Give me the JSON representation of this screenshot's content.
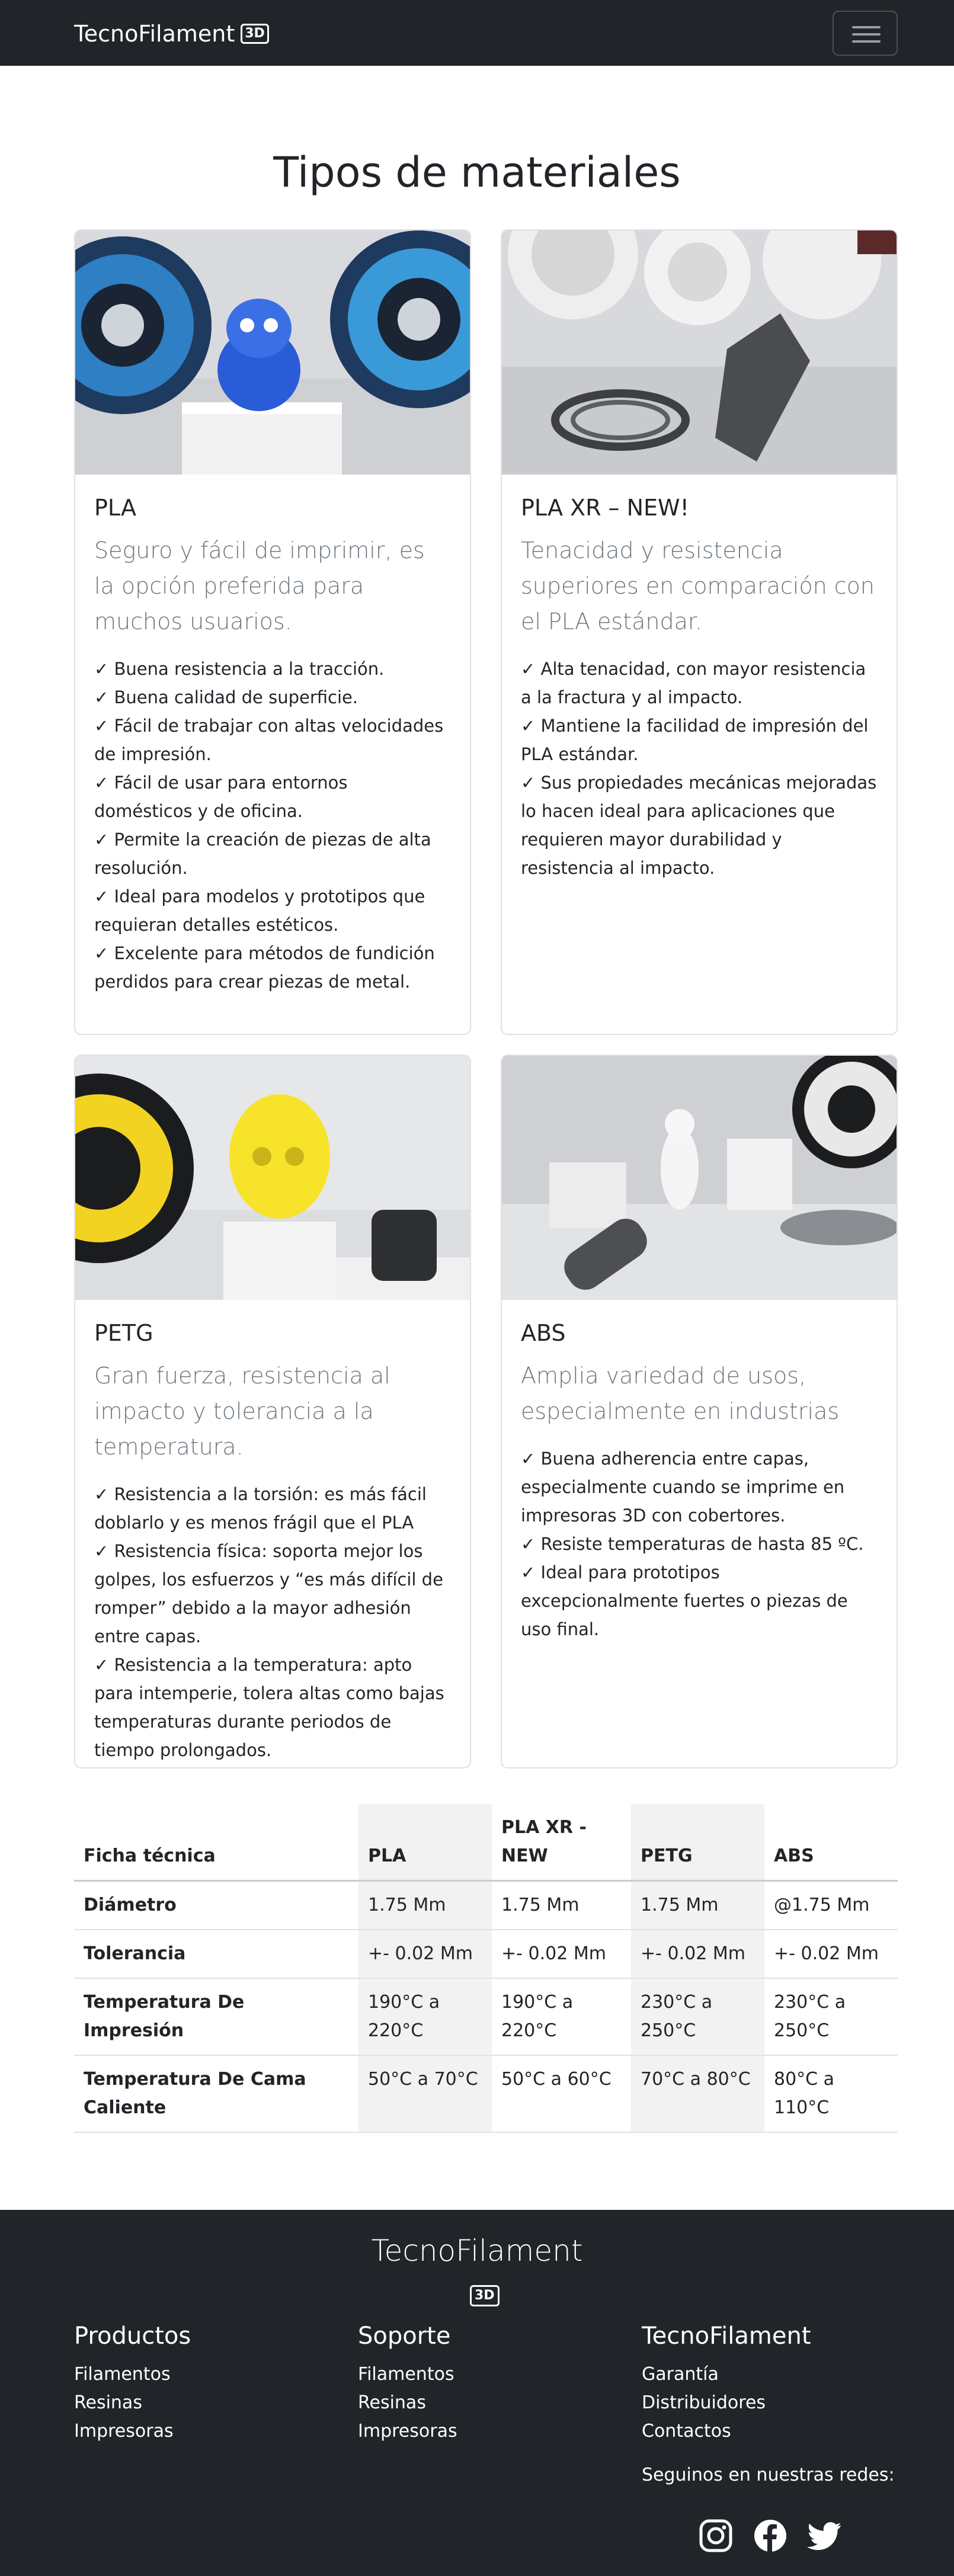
{
  "navbar": {
    "brand": "TecnoFilament",
    "badge": "3D"
  },
  "page_title": "Tipos de materiales",
  "cards": [
    {
      "title": "PLA",
      "lead": "Seguro y fácil de imprimir, es la opción preferida para muchos usuarios.",
      "features": [
        "✓ Buena resistencia a la tracción.",
        "✓ Buena calidad de superficie.",
        "✓ Fácil de trabajar con altas velocidades de impresión.",
        "✓ Fácil de usar para entornos domésticos y de oficina.",
        "✓ Permite la creación de piezas de alta resolución.",
        "✓ Ideal para modelos y prototipos que requieran detalles estéticos.",
        "✓ Excelente para métodos de fundición perdidos para crear piezas de metal."
      ]
    },
    {
      "title": "PLA XR – NEW!",
      "lead": "Tenacidad y resistencia superiores en comparación con el PLA estándar.",
      "features": [
        "✓ Alta tenacidad, con mayor resistencia a la fractura y al impacto.",
        "✓ Mantiene la facilidad de impresión del PLA estándar.",
        "✓ Sus propiedades mecánicas mejoradas lo hacen ideal para aplicaciones que requieren mayor durabilidad y resistencia al impacto."
      ]
    },
    {
      "title": "PETG",
      "lead": "Gran fuerza, resistencia al impacto y tolerancia a la temperatura.",
      "features": [
        "✓ Resistencia a la torsión: es más fácil doblarlo y es menos frágil que el PLA",
        "✓ Resistencia física: soporta mejor los golpes, los esfuerzos y “es más difícil de romper” debido a la mayor adhesión entre capas.",
        "✓ Resistencia a la temperatura: apto para intemperie, tolera altas como bajas temperaturas durante periodos de tiempo prolongados."
      ]
    },
    {
      "title": "ABS",
      "lead": "Amplia variedad de usos, especialmente en industrias",
      "features": [
        "✓ Buena adherencia entre capas, especialmente cuando se imprime en impresoras 3D con cobertores.",
        "✓ Resiste temperaturas de hasta 85 ºC.",
        "✓ Ideal para prototipos excepcionalmente fuertes o piezas de uso final."
      ]
    }
  ],
  "spec_table": {
    "headers": [
      "Ficha técnica",
      "PLA",
      "PLA XR - NEW",
      "PETG",
      "ABS"
    ],
    "rows": [
      [
        "Diámetro",
        "1.75 Mm",
        "1.75 Mm",
        "1.75 Mm",
        "@1.75 Mm"
      ],
      [
        "Tolerancia",
        "+- 0.02 Mm",
        "+- 0.02 Mm",
        "+- 0.02 Mm",
        "+- 0.02 Mm"
      ],
      [
        "Temperatura De Impresión",
        "190°C a 220°C",
        "190°C a 220°C",
        "230°C a 250°C",
        "230°C a 250°C"
      ],
      [
        "Temperatura De Cama Caliente",
        "50°C a 70°C",
        "50°C a 60°C",
        "70°C a 80°C",
        "80°C a 110°C"
      ]
    ]
  },
  "footer": {
    "brand": "TecnoFilament",
    "badge": "3D",
    "columns": [
      {
        "title": "Productos",
        "links": [
          "Filamentos",
          "Resinas",
          "Impresoras"
        ]
      },
      {
        "title": "Soporte",
        "links": [
          "Filamentos",
          "Resinas",
          "Impresoras"
        ]
      },
      {
        "title": "TecnoFilament",
        "links": [
          "Garantía",
          "Distribuidores",
          "Contactos"
        ]
      }
    ],
    "social_title": "Seguinos en nuestras redes:",
    "social_icons": [
      "instagram-icon",
      "facebook-icon",
      "twitter-icon"
    ]
  },
  "colors": {
    "dark": "#212529",
    "muted": "#6c757d",
    "border": "#dfe1e4"
  }
}
